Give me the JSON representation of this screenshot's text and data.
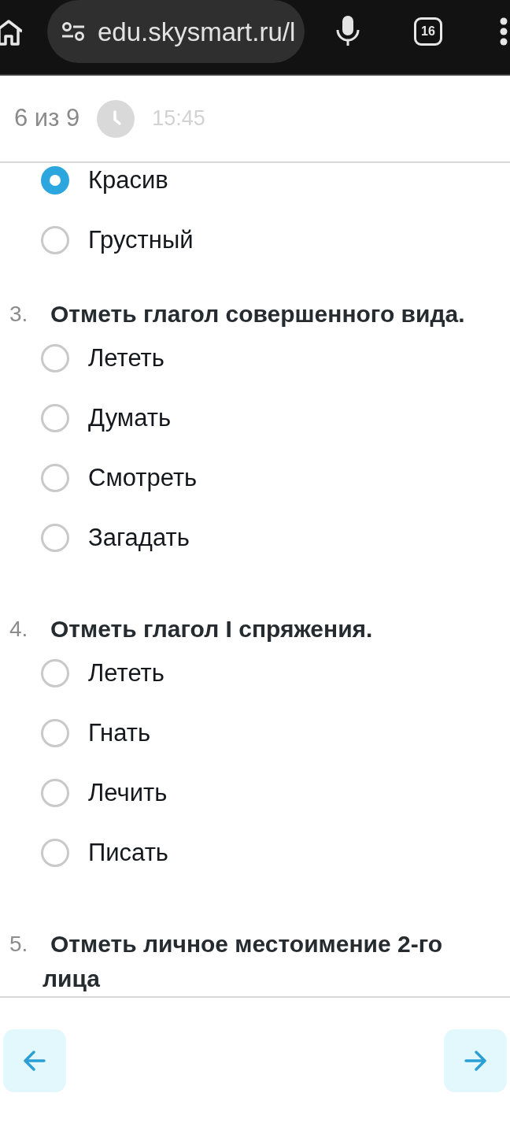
{
  "browser_bar": {
    "url": "edu.skysmart.ru/l",
    "tab_count": "16"
  },
  "header": {
    "progress": "6 из 9",
    "timer": "15:45"
  },
  "questions": [
    {
      "options": [
        {
          "label": "Красив",
          "selected": true
        },
        {
          "label": "Грустный",
          "selected": false
        }
      ]
    },
    {
      "number": "3.",
      "text": "Отметь глагол совершенного вида.",
      "options": [
        {
          "label": "Лететь",
          "selected": false
        },
        {
          "label": "Думать",
          "selected": false
        },
        {
          "label": "Смотреть",
          "selected": false
        },
        {
          "label": "Загадать",
          "selected": false
        }
      ]
    },
    {
      "number": "4.",
      "text": "Отметь глагол I спряжения.",
      "options": [
        {
          "label": "Лететь",
          "selected": false
        },
        {
          "label": "Гнать",
          "selected": false
        },
        {
          "label": "Лечить",
          "selected": false
        },
        {
          "label": "Писать",
          "selected": false
        }
      ]
    },
    {
      "number": "5.",
      "text": "Отметь личное местоимение 2-го лица"
    }
  ]
}
